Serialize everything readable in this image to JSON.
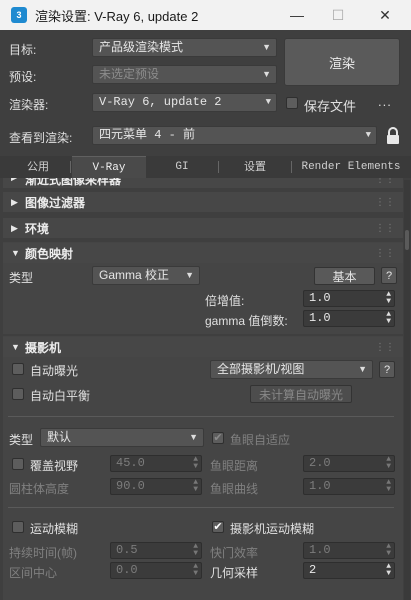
{
  "window": {
    "title": "渲染设置: V-Ray 6, update 2",
    "app_icon": "3ds-max-icon"
  },
  "header": {
    "target_label": "目标:",
    "target_value": "产品级渲染模式",
    "preset_label": "预设:",
    "preset_value": "未选定预设",
    "renderer_label": "渲染器:",
    "renderer_value": "V-Ray 6, update 2",
    "save_file_label": "保存文件",
    "save_file_checked": false,
    "more_label": "...",
    "view_label": "查看到渲染:",
    "view_value": "四元菜单 4 - 前",
    "render_button": "渲染"
  },
  "tabs": [
    {
      "label": "公用",
      "active": false
    },
    {
      "label": "V-Ray",
      "active": true
    },
    {
      "label": "GI",
      "active": false
    },
    {
      "label": "设置",
      "active": false
    },
    {
      "label": "Render Elements",
      "active": false
    }
  ],
  "rollouts": {
    "partial_title": "渐近式图像采样器",
    "image_filter": "图像过滤器",
    "environment": "环境",
    "color_mapping": "颜色映射",
    "camera": "摄影机"
  },
  "color_mapping": {
    "type_label": "类型",
    "type_value": "Gamma 校正",
    "mode_button": "基本",
    "multiplier_label": "倍增值:",
    "multiplier_value": "1.0",
    "gamma_label": "gamma 值倒数:",
    "gamma_value": "1.0"
  },
  "camera": {
    "auto_exposure_label": "自动曝光",
    "auto_exposure_checked": false,
    "auto_wb_label": "自动白平衡",
    "auto_wb_checked": false,
    "camera_select": "全部摄影机/视图",
    "help_button": "?",
    "calc_button": "未计算自动曝光",
    "type_label": "类型",
    "type_value": "默认",
    "fisheye_auto_label": "鱼眼自适应",
    "fisheye_auto_checked": true,
    "override_fov_label": "覆盖视野",
    "override_fov_checked": false,
    "override_fov_value": "45.0",
    "fisheye_dist_label": "鱼眼距离",
    "fisheye_dist_value": "2.0",
    "cyl_height_label": "圆柱体高度",
    "cyl_height_value": "90.0",
    "fisheye_curve_label": "鱼眼曲线",
    "fisheye_curve_value": "1.0",
    "motion_blur_label": "运动模糊",
    "motion_blur_checked": false,
    "camera_mb_label": "摄影机运动模糊",
    "camera_mb_checked": true,
    "duration_label": "持续时间(帧)",
    "duration_value": "0.5",
    "shutter_label": "快门效率",
    "shutter_value": "1.0",
    "interval_label": "区间中心",
    "interval_value": "0.0",
    "geo_samples_label": "几何采样",
    "geo_samples_value": "2"
  }
}
